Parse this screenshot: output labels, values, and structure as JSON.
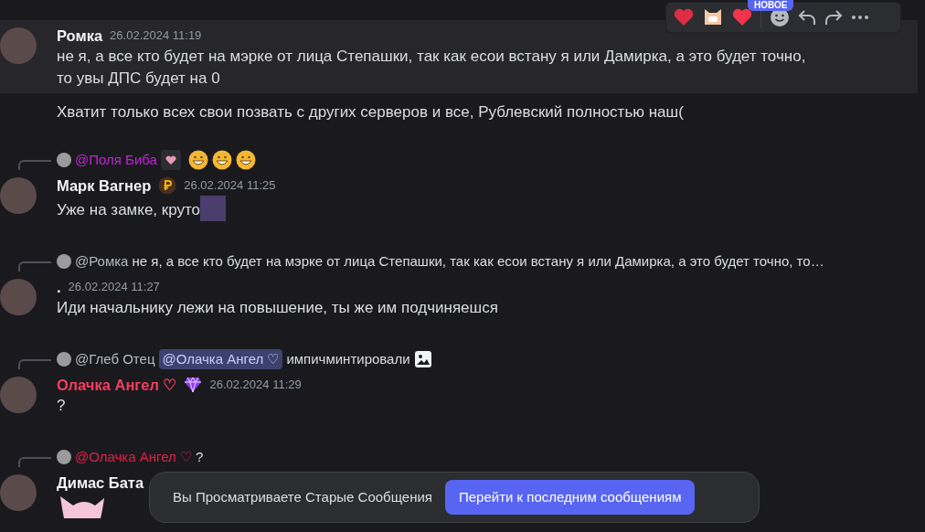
{
  "toolbar": {
    "badge": "НОВОЕ"
  },
  "messages": [
    {
      "author": "Ромка",
      "timestamp": "26.02.2024 11:19",
      "hovered": true,
      "content": [
        {
          "kind": "text",
          "text": "не я, а все кто будет на мэрке от лица Степашки, так как есои встану я или Дамирка, а это будет точно, то увы ДПС будет на 0"
        }
      ],
      "continuations": [
        "Хватит только всех свои позвать с других серверов и все, Рублевский полностью наш("
      ]
    },
    {
      "author": "Марк Вагнер",
      "timestamp": "26.02.2024 11:25",
      "hovered": false,
      "badge": {
        "kind": "coin"
      },
      "reply": {
        "mention": "@Поля Биба",
        "color": "#c026d3",
        "tail": [
          {
            "kind": "heart-chip"
          },
          {
            "kind": "grin"
          },
          {
            "kind": "grin"
          },
          {
            "kind": "grin"
          }
        ]
      },
      "content": [
        {
          "kind": "text",
          "text": "Уже на замке, круто"
        },
        {
          "kind": "sticker"
        }
      ]
    },
    {
      "author": ".",
      "timestamp": "26.02.2024 11:27",
      "hovered": false,
      "reply": {
        "mention": "@Ромка",
        "color": "#b5bac1",
        "text": "не я, а все кто будет на мэрке от лица Степашки, так как есои встану я или Дамирка, а это будет точно, то…"
      },
      "content": [
        {
          "kind": "text",
          "text": "Иди начальнику лежи на повышение, ты же им подчиняешся"
        }
      ]
    },
    {
      "author": "Олачка Ангел ♡",
      "color": "#f23f5e",
      "timestamp": "26.02.2024 11:29",
      "hovered": false,
      "badge": {
        "kind": "gem"
      },
      "reply": {
        "mention": "@Глеб Отец",
        "color": "#b5bac1",
        "highlight": "@Олачка Ангел ♡",
        "text": "импичминтировали",
        "tail": [
          {
            "kind": "image"
          }
        ]
      },
      "content": [
        {
          "kind": "text",
          "text": "?"
        }
      ]
    },
    {
      "author": "Димас Бата",
      "hovered": false,
      "reply": {
        "mention": "@Олачка Ангел ♡",
        "color": "#e0204a",
        "text": "?"
      },
      "content": [
        {
          "kind": "bunny"
        }
      ]
    }
  ],
  "toast": {
    "text": "Вы Просматриваете Старые Сообщения",
    "button": "Перейти к последним сообщениям"
  }
}
